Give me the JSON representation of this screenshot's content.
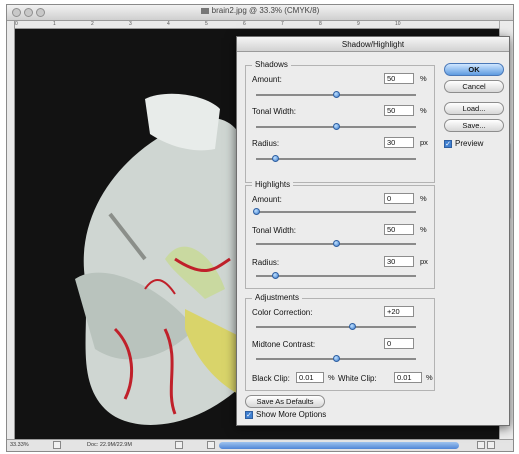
{
  "window": {
    "title": "brain2.jpg @ 33.3% (CMYK/8)"
  },
  "ruler": {
    "top_ticks": [
      "0",
      "1",
      "2",
      "3",
      "4",
      "5",
      "6",
      "7",
      "8",
      "9",
      "10"
    ]
  },
  "status": {
    "zoom": "33.33%",
    "doc": "Doc: 22.9M/22.9M"
  },
  "dialog": {
    "title": "Shadow/Highlight",
    "shadows": {
      "label": "Shadows",
      "amount_label": "Amount:",
      "amount_value": "50",
      "amount_unit": "%",
      "amount_level": 0.5,
      "tonal_label": "Tonal Width:",
      "tonal_value": "50",
      "tonal_unit": "%",
      "tonal_level": 0.5,
      "radius_label": "Radius:",
      "radius_value": "30",
      "radius_unit": "px",
      "radius_level": 0.12
    },
    "highlights": {
      "label": "Highlights",
      "amount_label": "Amount:",
      "amount_value": "0",
      "amount_unit": "%",
      "amount_level": 0.0,
      "tonal_label": "Tonal Width:",
      "tonal_value": "50",
      "tonal_unit": "%",
      "tonal_level": 0.5,
      "radius_label": "Radius:",
      "radius_value": "30",
      "radius_unit": "px",
      "radius_level": 0.12
    },
    "adjustments": {
      "label": "Adjustments",
      "color_label": "Color Correction:",
      "color_value": "+20",
      "color_level": 0.6,
      "midtone_label": "Midtone Contrast:",
      "midtone_value": "0",
      "midtone_level": 0.5,
      "black_clip_label": "Black Clip:",
      "black_clip_value": "0.01",
      "black_clip_unit": "%",
      "white_clip_label": "White Clip:",
      "white_clip_value": "0.01",
      "white_clip_unit": "%"
    },
    "buttons": {
      "ok": "OK",
      "cancel": "Cancel",
      "load": "Load...",
      "save": "Save..."
    },
    "preview_label": "Preview",
    "save_defaults": "Save As Defaults",
    "show_more": "Show More Options"
  },
  "colors": {
    "accent": "#3f7fd0",
    "canvas": "#121212"
  }
}
